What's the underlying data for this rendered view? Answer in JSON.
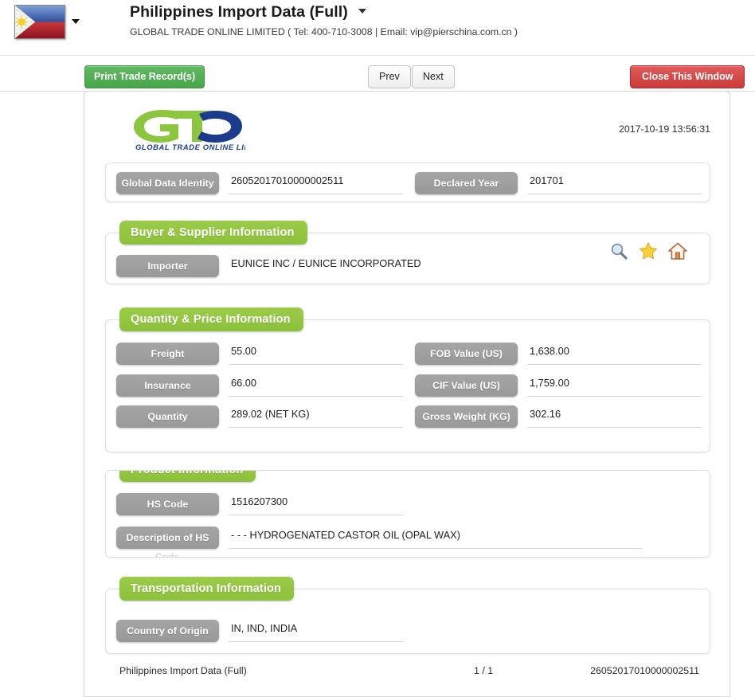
{
  "header": {
    "flag_icon": "philippines-flag-icon",
    "flag_caret_icon": "chevron-down-icon",
    "title": "Philippines Import Data (Full)",
    "title_caret_icon": "chevron-down-icon",
    "subtitle": "GLOBAL TRADE ONLINE LIMITED ( Tel: 400-710-3008  |  Email: vip@pierschina.com.cn )"
  },
  "toolbar": {
    "print_label": "Print Trade Record(s)",
    "prev_label": "Prev",
    "next_label": "Next",
    "close_label": "Close This Window"
  },
  "document": {
    "logo_text": "GLOBAL TRADE ONLINE LIMITED",
    "timestamp": "2017-10-19 13:56:31",
    "identity": {
      "global_data_identity_label": "Global Data Identity",
      "global_data_identity_value": "26052017010000002511",
      "declared_year_label": "Declared Year",
      "declared_year_value": "201701"
    },
    "sections": {
      "buyer_supplier": {
        "title": "Buyer & Supplier Information",
        "importer_label": "Importer",
        "importer_value": "EUNICE INC / EUNICE INCORPORATED",
        "icons": [
          "search-icon",
          "star-icon",
          "home-icon"
        ]
      },
      "quantity_price": {
        "title": "Quantity & Price Information",
        "freight_label": "Freight",
        "freight_value": "55.00",
        "insurance_label": "Insurance",
        "insurance_value": "66.00",
        "quantity_label": "Quantity",
        "quantity_value": "289.02 (NET KG)",
        "fob_label": "FOB Value (US)",
        "fob_value": "1,638.00",
        "cif_label": "CIF Value (US)",
        "cif_value": "1,759.00",
        "gross_weight_label": "Gross Weight (KG)",
        "gross_weight_value": "302.16"
      },
      "product": {
        "title": "Product Information",
        "hs_code_label": "HS Code",
        "hs_code_value": "1516207300",
        "description_label": "Description of HS",
        "description_value": "- - - HYDROGENATED CASTOR OIL (OPAL WAX)",
        "ghost_text": "Code"
      },
      "transportation": {
        "title": "Transportation Information",
        "country_of_origin_label": "Country of Origin",
        "country_of_origin_value": "IN, IND, INDIA"
      }
    },
    "footer": {
      "left": "Philippines Import Data (Full)",
      "middle": "1 / 1",
      "right": "26052017010000002511"
    }
  },
  "colors": {
    "green_accent": "#8CC03A",
    "gray_pill": "#999999",
    "red_button": "#CC3A3A",
    "green_button": "#46A648",
    "logo_blue": "#1B3C8C"
  }
}
